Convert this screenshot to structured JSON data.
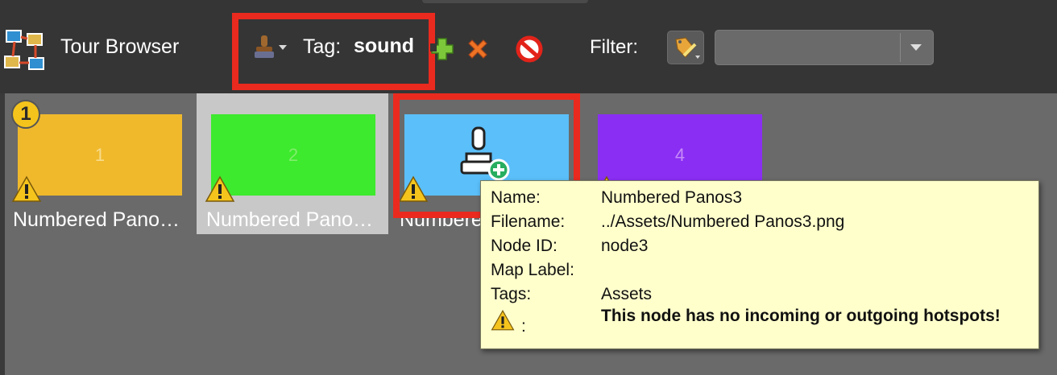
{
  "app": {
    "title": "Tour Browser",
    "icon": "tour-browser-icon"
  },
  "toolbar": {
    "tag_label": "Tag:",
    "tag_value": "sound",
    "stamp_icon": "stamp-icon",
    "add_icon": "plus-icon",
    "remove_icon": "x-icon",
    "clear_icon": "no-entry-icon",
    "filter_label": "Filter:",
    "filter_value": ""
  },
  "tiles": [
    {
      "number": "1",
      "label": "Numbered Pano…",
      "color": "#f0b92c",
      "badge": "1",
      "warning": true,
      "selected": false
    },
    {
      "number": "2",
      "label": "Numbered Pano…",
      "color": "#3dea2d",
      "warning": true,
      "selected": true
    },
    {
      "number": "",
      "label": "Numbere",
      "color": "#5bbff9",
      "warning": true,
      "selected": false,
      "overlay_icon": "stamp-add-icon"
    },
    {
      "number": "4",
      "label": "",
      "color": "#8a2ef3",
      "warning": true,
      "selected": false
    }
  ],
  "tooltip": {
    "rows": [
      {
        "key": "Name:",
        "value": "Numbered Panos3"
      },
      {
        "key": "Filename:",
        "value": "../Assets/Numbered Panos3.png"
      },
      {
        "key": "Node ID:",
        "value": "node3"
      },
      {
        "key": "Map Label:",
        "value": ""
      },
      {
        "key": "Tags:",
        "value": "Assets"
      },
      {
        "key": ":",
        "value": "This node has no incoming or outgoing hotspots!"
      }
    ]
  },
  "colors": {
    "highlight": "#ea2a1f",
    "tooltip_bg": "#ffffcc",
    "warning": "#f5c41c"
  }
}
